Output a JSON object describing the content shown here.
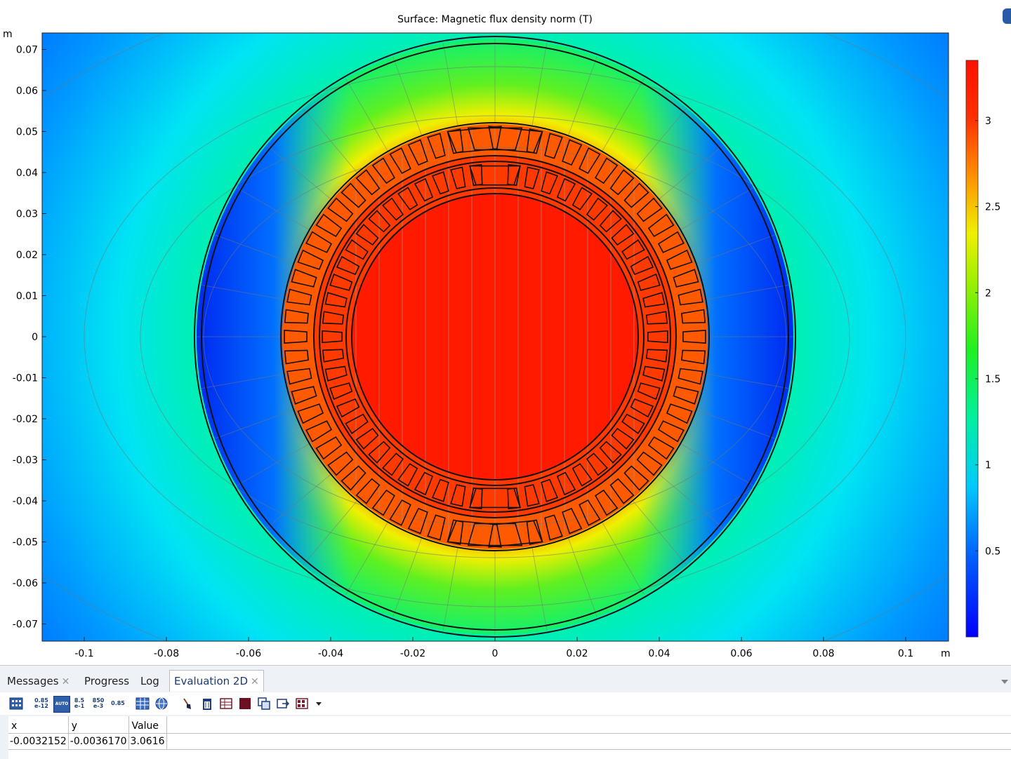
{
  "plot": {
    "title": "Surface: Magnetic flux density norm (T)",
    "x_unit": "m",
    "y_unit": "m",
    "x_ticks": [
      "-0.1",
      "-0.08",
      "-0.06",
      "-0.04",
      "-0.02",
      "0",
      "0.02",
      "0.04",
      "0.06",
      "0.08",
      "0.1"
    ],
    "y_ticks": [
      "0.07",
      "0.06",
      "0.05",
      "0.04",
      "0.03",
      "0.02",
      "0.01",
      "0",
      "-0.01",
      "-0.02",
      "-0.03",
      "-0.04",
      "-0.05",
      "-0.06",
      "-0.07"
    ],
    "colorbar_ticks": [
      "3",
      "2.5",
      "2",
      "1.5",
      "1",
      "0.5"
    ],
    "colorbar_range": [
      0,
      3.35
    ],
    "colormap": [
      "#0000ff",
      "#0090ff",
      "#00e8f8",
      "#00f070",
      "#7ef000",
      "#f0f000",
      "#ff8000",
      "#ff1800"
    ]
  },
  "panel": {
    "tabs": [
      {
        "label": "Messages",
        "closable": true
      },
      {
        "label": "Progress",
        "closable": false
      },
      {
        "label": "Log",
        "closable": false
      },
      {
        "label": "Evaluation 2D",
        "closable": true,
        "active": true
      }
    ],
    "close_glyph": "✕",
    "toolbar": {
      "precision_icon_1": [
        "0.85",
        "e-12"
      ],
      "auto_icon": "AUTO",
      "precision_icon_2": [
        "8.5",
        "e-1"
      ],
      "precision_icon_3": [
        "850",
        "e-3"
      ],
      "precision_icon_4": "0.85"
    },
    "table": {
      "headers": [
        "x",
        "y",
        "Value"
      ],
      "rows": [
        [
          "-0.0032152",
          "-0.0036170",
          "3.0616"
        ]
      ]
    }
  }
}
